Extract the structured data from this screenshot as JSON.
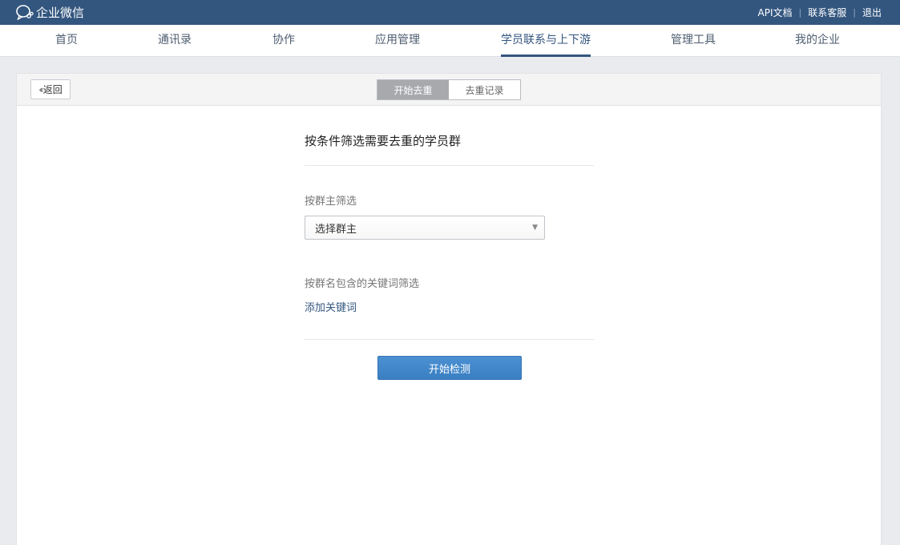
{
  "brand": {
    "name": "企业微信",
    "icon": "wecom-chat-icon"
  },
  "top_links": [
    {
      "label": "API文档"
    },
    {
      "label": "联系客服"
    },
    {
      "label": "退出"
    }
  ],
  "nav": {
    "items": [
      {
        "label": "首页"
      },
      {
        "label": "通讯录"
      },
      {
        "label": "协作"
      },
      {
        "label": "应用管理"
      },
      {
        "label": "学员联系与上下游",
        "active": true
      },
      {
        "label": "管理工具"
      },
      {
        "label": "我的企业"
      }
    ]
  },
  "panel": {
    "back_label": "返回",
    "tabs": [
      {
        "label": "开始去重",
        "active": true
      },
      {
        "label": "去重记录",
        "active": false
      }
    ]
  },
  "form": {
    "title": "按条件筛选需要去重的学员群",
    "owner_label": "按群主筛选",
    "owner_select_value": "选择群主",
    "keyword_label": "按群名包含的关键词筛选",
    "add_keyword_link": "添加关键词",
    "submit_label": "开始检测"
  },
  "colors": {
    "topbar": "#33567f",
    "accent": "#33567f",
    "primary_button": "#3a7fc2"
  }
}
